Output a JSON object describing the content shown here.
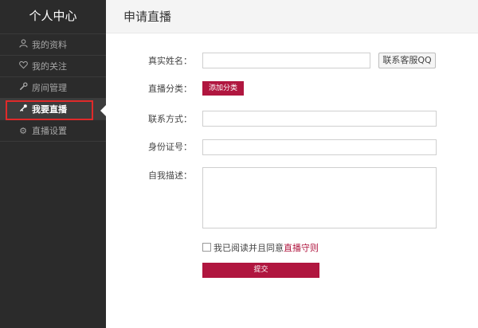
{
  "sidebar": {
    "title": "个人中心",
    "items": [
      {
        "label": "我的资料",
        "icon": "user-icon"
      },
      {
        "label": "我的关注",
        "icon": "heart-icon"
      },
      {
        "label": "房间管理",
        "icon": "wrench-icon"
      },
      {
        "label": "我要直播",
        "icon": "key-icon",
        "active": true
      },
      {
        "label": "直播设置",
        "icon": "gear-icon"
      }
    ]
  },
  "header": {
    "title": "申请直播"
  },
  "form": {
    "real_name": {
      "label": "真实姓名：",
      "value": ""
    },
    "contact_qq_button": "联系客服QQ",
    "category": {
      "label": "直播分类：",
      "button": "添加分类"
    },
    "contact": {
      "label": "联系方式：",
      "value": ""
    },
    "id_number": {
      "label": "身份证号：",
      "value": ""
    },
    "description": {
      "label": "自我描述：",
      "value": ""
    },
    "agree": {
      "text": "我已阅读并且同意",
      "link": "直播守则",
      "checked": false
    },
    "submit": "提交"
  },
  "colors": {
    "sidebar_bg": "#2b2b2b",
    "accent": "#b0163f",
    "highlight_outline": "#e02a2a"
  }
}
